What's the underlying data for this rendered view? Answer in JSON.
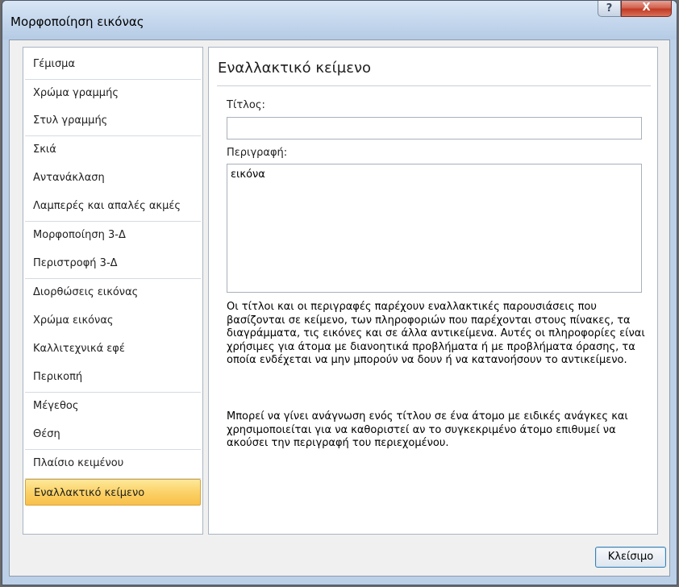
{
  "window": {
    "title": "Μορφοποίηση εικόνας",
    "help_glyph": "?",
    "close_glyph": "X"
  },
  "sidebar": {
    "items": [
      {
        "label": "Γέμισμα"
      },
      {
        "label": "Χρώμα γραμμής"
      },
      {
        "label": "Στυλ γραμμής"
      },
      {
        "label": "Σκιά"
      },
      {
        "label": "Αντανάκλαση"
      },
      {
        "label": "Λαμπερές και απαλές ακμές"
      },
      {
        "label": "Μορφοποίηση 3-Δ"
      },
      {
        "label": "Περιστροφή 3-Δ"
      },
      {
        "label": "Διορθώσεις εικόνας"
      },
      {
        "label": "Χρώμα εικόνας"
      },
      {
        "label": "Καλλιτεχνικά εφέ"
      },
      {
        "label": "Περικοπή"
      },
      {
        "label": "Μέγεθος"
      },
      {
        "label": "Θέση"
      },
      {
        "label": "Πλαίσιο κειμένου"
      },
      {
        "label": "Εναλλακτικό κείμενο"
      }
    ],
    "selected_index": 15
  },
  "panel": {
    "title": "Εναλλακτικό κείμενο",
    "title_label": "Τίτλος:",
    "title_value": "",
    "description_label": "Περιγραφή:",
    "description_value": "εικόνα",
    "info_paragraph_1": "Οι τίτλοι και οι περιγραφές παρέχουν εναλλακτικές παρουσιάσεις που βασίζονται σε κείμενο, των πληροφοριών που παρέχονται στους πίνακες, τα διαγράμματα, τις εικόνες και σε άλλα αντικείμενα. Αυτές οι πληροφορίες είναι χρήσιμες για άτομα με διανοητικά προβλήματα ή με προβλήματα όρασης, τα οποία ενδέχεται να μην μπορούν να δουν ή να κατανοήσουν το αντικείμενο.",
    "info_paragraph_2": "Μπορεί να γίνει ανάγνωση ενός τίτλου σε ένα άτομο με ειδικές ανάγκες και χρησιμοποιείται για να καθοριστεί αν το συγκεκριμένο άτομο επιθυμεί να ακούσει την περιγραφή του περιεχομένου."
  },
  "footer": {
    "close_label": "Κλείσιμο"
  },
  "colors": {
    "selected_item": "#fbd268",
    "title_close": "#c23a24"
  }
}
